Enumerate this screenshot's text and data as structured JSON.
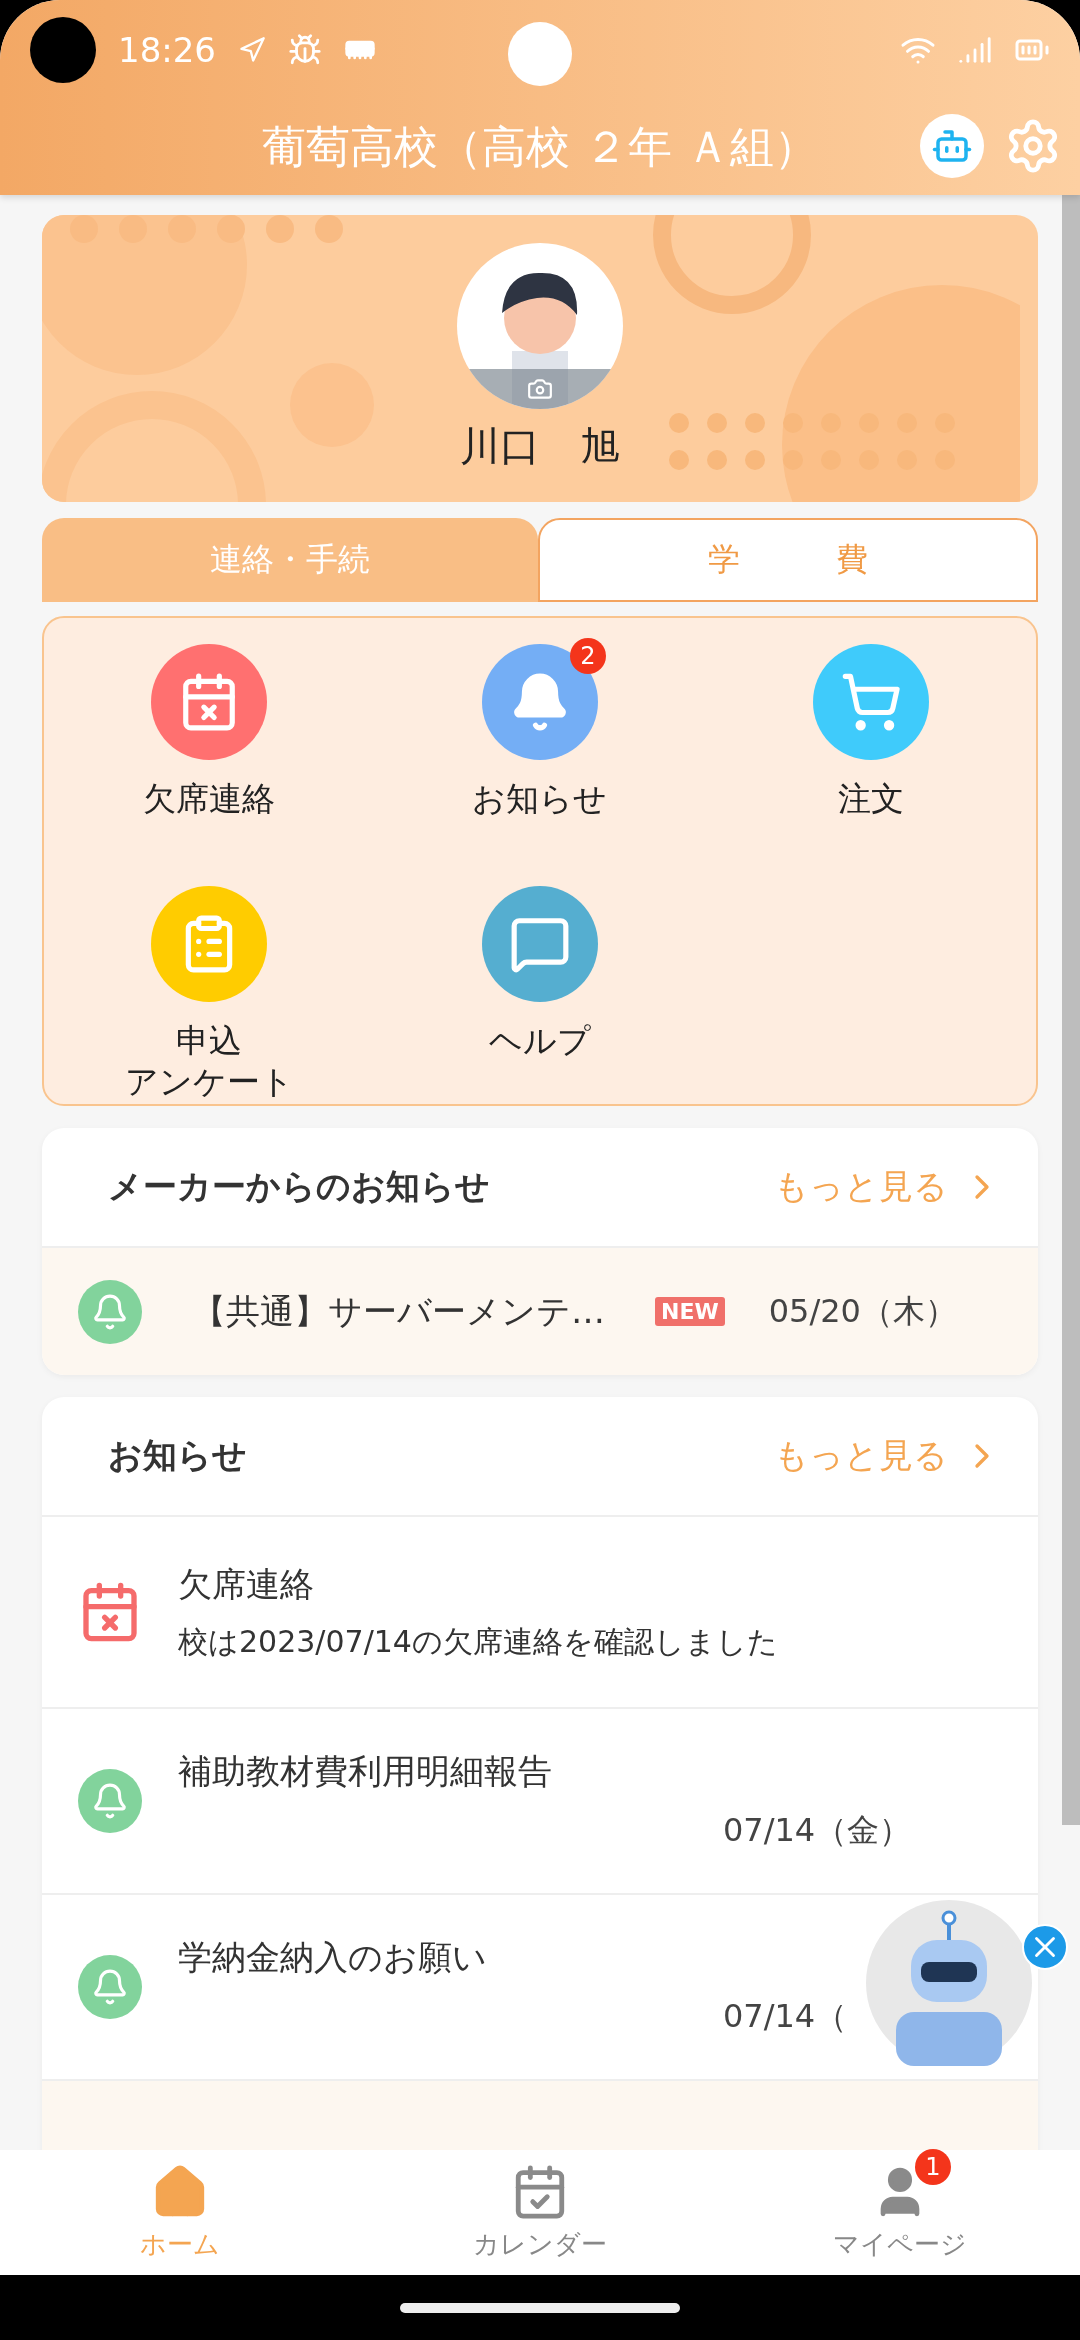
{
  "status_bar": {
    "time": "18:26"
  },
  "header": {
    "title": "葡萄高校（高校 ２年 Ａ組）"
  },
  "profile": {
    "name": "川口　旭"
  },
  "tabs": [
    {
      "label": "連絡・手続",
      "selected": true
    },
    {
      "label": "学　　　費",
      "selected": false
    }
  ],
  "menu": [
    {
      "kind": "absence",
      "label": "欠席連絡",
      "color": "#ff7070"
    },
    {
      "kind": "notice",
      "label": "お知らせ",
      "color": "#74aef5",
      "badge": "2"
    },
    {
      "kind": "order",
      "label": "注文",
      "color": "#3fcbfb"
    },
    {
      "kind": "apply",
      "label": "申込",
      "label_line_2": "アンケート",
      "color": "#ffcc00"
    },
    {
      "kind": "help",
      "label": "ヘルプ",
      "color": "#55aed0"
    }
  ],
  "maker_notices": {
    "title": "メーカーからのお知らせ",
    "more": "もっと見る",
    "items": [
      {
        "title": "【共通】サーバーメンテ…",
        "new_label": "NEW",
        "date": "05/20（木）",
        "unread": true
      }
    ]
  },
  "notices": {
    "title": "お知らせ",
    "more": "もっと見る",
    "items": [
      {
        "kind": "absence",
        "title": "欠席連絡",
        "body": "校は2023/07/14の欠席連絡を確認しました",
        "unread": false
      },
      {
        "kind": "bell",
        "title": "補助教材費利用明細報告",
        "date": "07/14（金）",
        "unread": false
      },
      {
        "kind": "bell",
        "title": "学納金納入のお願い",
        "date": "07/14（",
        "unread": false
      },
      {
        "kind": "blank",
        "unread": true
      }
    ]
  },
  "bottom_nav": [
    {
      "kind": "home",
      "label": "ホーム",
      "selected": true
    },
    {
      "kind": "calendar",
      "label": "カレンダー",
      "selected": false
    },
    {
      "kind": "mypage",
      "label": "マイページ",
      "selected": false,
      "badge": "1"
    }
  ]
}
